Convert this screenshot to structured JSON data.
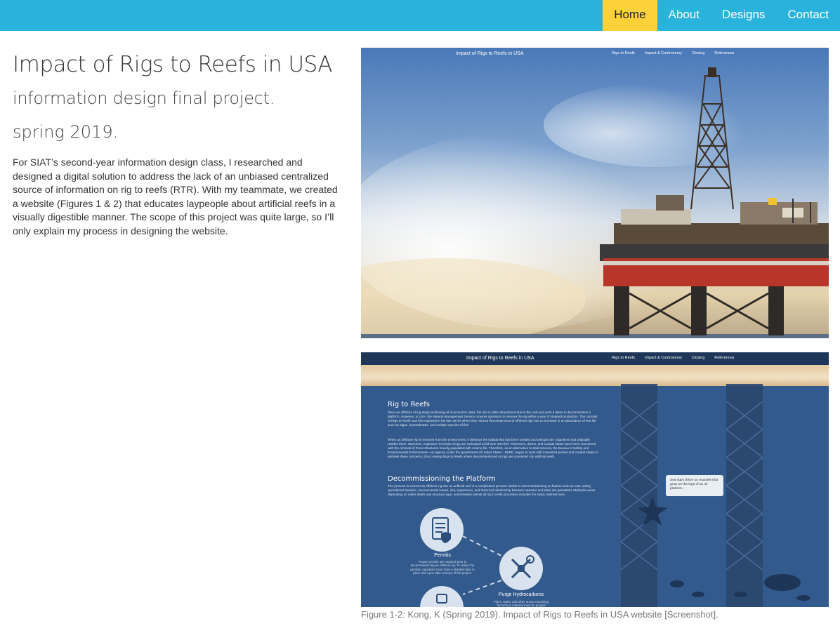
{
  "nav": {
    "items": [
      "Home",
      "About",
      "Designs",
      "Contact"
    ],
    "active_index": 0
  },
  "hero": {
    "title": "Impact of Rigs to Reefs in USA",
    "subtitle": "information design final project.",
    "term": "spring 2019.",
    "description": "For SIAT’s second-year information design class, I researched and designed a digital solution to address the lack of an unbiased centralized source of information on rig to reefs (RTR). With my teammate, we created a website (Figures 1 & 2) that educates laypeople about artificial reefs in a visually digestible manner. The scope of this project was quite large, so I’ll only explain my process in designing the website."
  },
  "figure1": {
    "site_title": "Impact of Rigs to Reefs in USA",
    "links": [
      "Rigs to Reefs",
      "Impact & Controversy",
      "Closing",
      "References"
    ]
  },
  "figure2": {
    "site_title": "Impact of Rigs to Reefs in USA",
    "links": [
      "Rigs to Reefs",
      "Impact & Controversy",
      "Closing",
      "References"
    ],
    "section1_heading": "Rig to Reefs",
    "section1_text_a": "Once an offshore oil rig stops producing oil at economic rates, the site is often abandoned due to the cost and work it takes to decommission a platform. However, in USA, the Mineral Management Service requires operators to remove the rig within a year of stopped production. The concept of Rigs to Reefs was first explored in the late 1970s when they noticed that areas around offshore rigs has an increase in an abundance of sea life such as algae, invertebrates, and multiple species of fish.",
    "section1_text_b": "When an offshore rig is removed from the environment, it destroys the habitat that has been created and disrupts the organisms that originally resides there. Moreover, explosive removals of rigs are estimated to kill over 300 fish. Fishermen, divers, and coastal states have been concerned with the removal of these structures heavily populated with marine life. Therefore, as an alternative to total removal, the Bureau of Safety and Environmental Enforcement—an agency under the government of United States - BSEE, began to work with interested parties and coastal states to address these concerns, thus creating Rigs to Reefs where decommissioned oil rigs are converted into artificial reefs.",
    "section2_heading": "Decommissioning the Platform",
    "section2_text": "The process to convert an offshore rig into an artificial reef is a complicated process similar to decommissioning as factors such as cost, safety, operational duration, environmental issues, risk, experience, and historical relationship between operator and state are persistent. Methods varies depending on water depth and structure type, nevertheless almost all rig to reefs processes includes the steps outlined here.",
    "bubble_text": "Sea stars thrive on mussels that grow on the legs of an oil platform.",
    "step1_label": "Permits",
    "step1_desc": "Proper permits are required prior to decommissioning an offshore rig. To obtain the permits, operators must have a detailed plan in place and up to date surveys of the project.",
    "step2_label": "Purge Hydrocarbons",
    "step2_desc": "Pipes, tanks, and other areas containing hazardous material must be purged"
  },
  "caption": "Figure 1-2: Kong, K (Spring 2019). Impact of Rigs to Reefs in USA website [Screenshot].",
  "colors": {
    "nav_bg": "#29b3dc",
    "nav_active": "#fdd13a",
    "site_blue": "#335a8c"
  }
}
